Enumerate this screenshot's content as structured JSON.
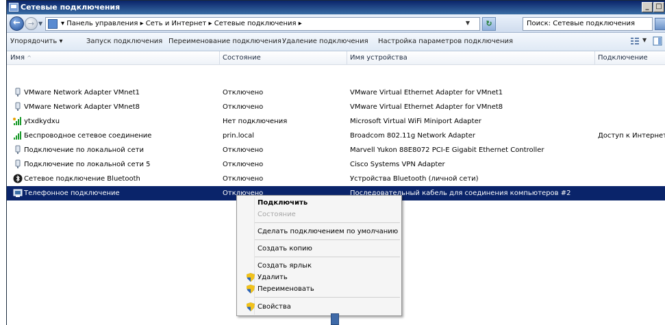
{
  "window": {
    "title": "Сетевые подключения",
    "btn_minimize": "_",
    "btn_maximize": "□",
    "btn_close": "x"
  },
  "address": {
    "breadcrumb": "▾  Панель управления  ▸  Сеть и Интернет  ▸  Сетевые подключения  ▸",
    "search_placeholder": "Поиск: Сетевые подключения"
  },
  "commands": [
    "Упорядочить ▾",
    "Запуск подключения",
    "Переименование подключения",
    "Удаление подключения",
    "Настройка параметров подключения"
  ],
  "columns": [
    "Имя",
    "Состояние",
    "Имя устройства",
    "Подключение"
  ],
  "rows": [
    {
      "name": "VMware Network Adapter VMnet1",
      "status": "Отключено",
      "device": "VMware Virtual Ethernet Adapter for VMnet1",
      "connection": "",
      "icon": "disconnected-adapter-icon"
    },
    {
      "name": "VMware Network Adapter VMnet8",
      "status": "Отключено",
      "device": "VMware Virtual Ethernet Adapter for VMnet8",
      "connection": "",
      "icon": "disconnected-adapter-icon"
    },
    {
      "name": "ytxdkydxu",
      "status": "Нет подключения",
      "device": "Microsoft Virtual WiFi Miniport Adapter",
      "connection": "",
      "icon": "wifi-signal-icon"
    },
    {
      "name": "Беспроводное сетевое соединение",
      "status": "prin.local",
      "device": "Broadcom 802.11g Network Adapter",
      "connection": "Доступ к Интернету",
      "icon": "wifi-signal-icon"
    },
    {
      "name": "Подключение по локальной сети",
      "status": "Отключено",
      "device": "Marvell Yukon 88E8072 PCI-E Gigabit Ethernet Controller",
      "connection": "",
      "icon": "disconnected-adapter-icon"
    },
    {
      "name": "Подключение по локальной сети 5",
      "status": "Отключено",
      "device": "Cisco Systems VPN Adapter",
      "connection": "",
      "icon": "disconnected-adapter-icon"
    },
    {
      "name": "Сетевое подключение Bluetooth",
      "status": "Отключено",
      "device": "Устройства Bluetooth (личной сети)",
      "connection": "",
      "icon": "bluetooth-icon"
    },
    {
      "name": "Телефонное подключение",
      "status": "Отключено",
      "device": "Последовательный кабель для соединения компьютеров #2",
      "connection": "",
      "icon": "dialup-icon",
      "selected": true
    }
  ],
  "context_menu": {
    "connect": "Подключить",
    "status": "Состояние",
    "set_default": "Сделать подключением по умолчанию",
    "create_copy": "Создать копию",
    "create_shortcut": "Создать ярлык",
    "delete": "Удалить",
    "rename": "Переименовать",
    "properties": "Свойства"
  },
  "colors": {
    "selection": "#0a246a",
    "titlebar": "#0a246a"
  }
}
